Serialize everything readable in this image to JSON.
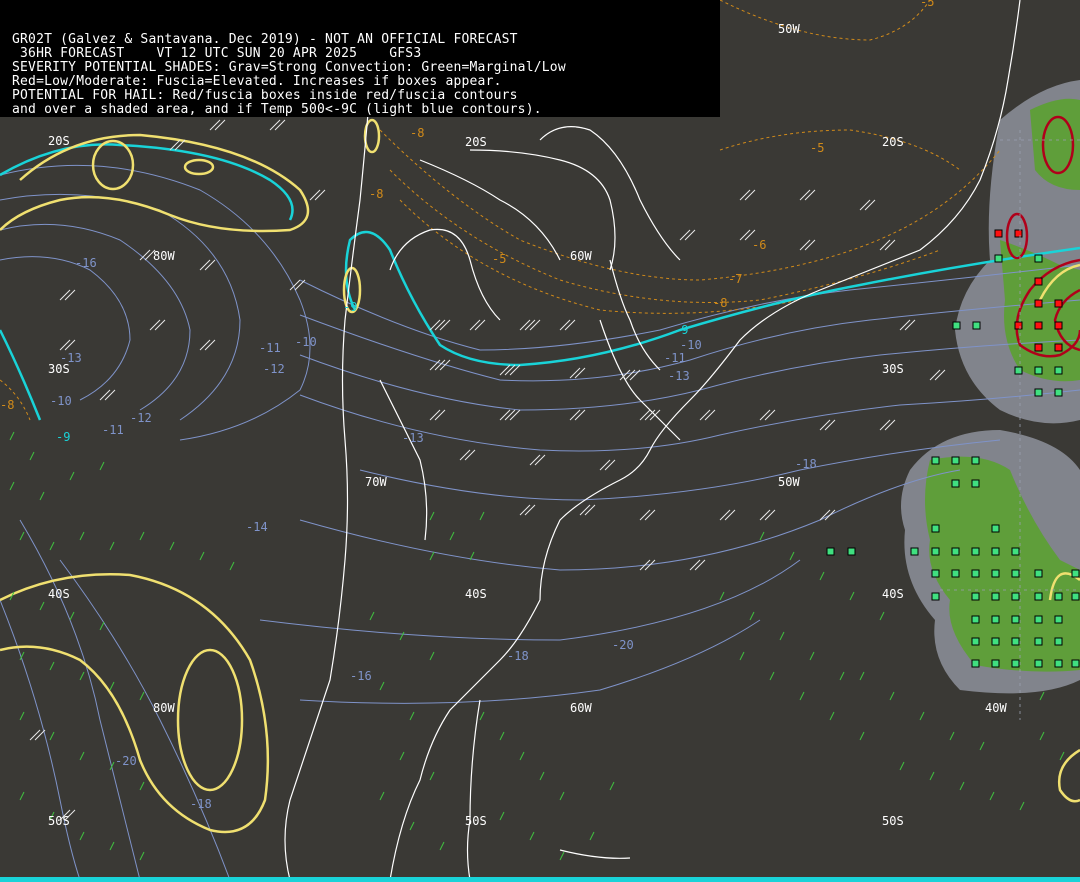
{
  "header": {
    "lines": [
      "GR02T (Galvez & Santavana. Dec 2019) - NOT AN OFFICIAL FORECAST",
      " 36HR FORECAST    VT 12 UTC SUN 20 APR 2025    GFS3",
      "SEVERITY POTENTIAL SHADES: Grav=Strong Convection: Green=Marginal/Low",
      "Red=Low/Moderate: Fuscia=Elevated. Increases if boxes appear.",
      "POTENTIAL FOR HAIL: Red/fuscia boxes inside red/fuscia contours",
      "and over a shaded area, and if Temp 500<-9C (light blue contours)."
    ]
  },
  "grid_labels": {
    "lat": [
      "20S",
      "20S",
      "20S",
      "30S",
      "30S",
      "40S",
      "40S",
      "40S",
      "50S",
      "50S",
      "50S"
    ],
    "lon": [
      "50W",
      "60W",
      "80W",
      "70W",
      "50W",
      "80W",
      "60W",
      "40W"
    ]
  },
  "temperature_labels": [
    "-5",
    "-5",
    "-5",
    "-6",
    "-7",
    "-8",
    "-8",
    "-8",
    "-9",
    "-9",
    "-9",
    "-10",
    "-10",
    "-11",
    "-11",
    "-12",
    "-12",
    "-13",
    "-13",
    "-14",
    "-16",
    "-18",
    "-18",
    "-20",
    "-18",
    "-10",
    "-11",
    "-13",
    "-16",
    "-8",
    "-20"
  ],
  "colors": {
    "background": "#3a3935",
    "coast": "#ffffff",
    "temp_contour": "#7f93c9",
    "warm_contour": "#d08a1a",
    "cyan_contour": "#19d3d8",
    "yellow_contour": "#f0e070",
    "gray_shade": "#8a8d96",
    "green_shade": "#5f9e3a",
    "red_contour": "#b0001a",
    "barb_white": "#e8e8e8",
    "barb_green": "#3fc23f",
    "box_green": "#40e080",
    "box_red": "#ff1010"
  }
}
